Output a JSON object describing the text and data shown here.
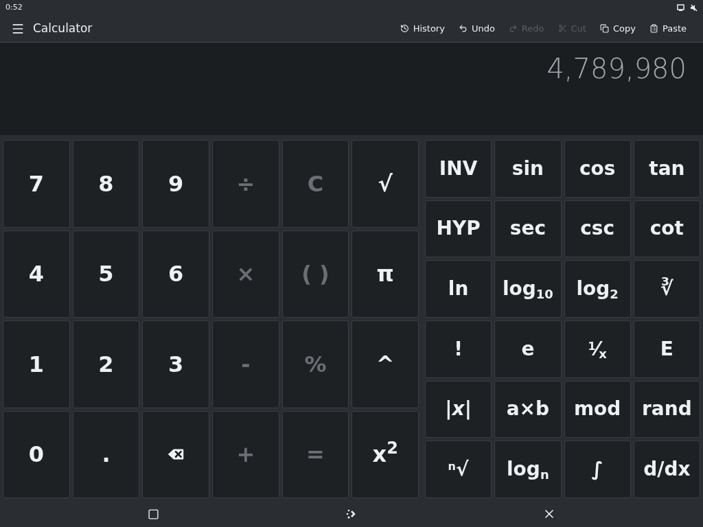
{
  "status_bar": {
    "time": "0:52"
  },
  "header": {
    "title": "Calculator",
    "actions": [
      {
        "label": "History",
        "kind": "clock",
        "disabled": false
      },
      {
        "label": "Undo",
        "kind": "undo",
        "disabled": false
      },
      {
        "label": "Redo",
        "kind": "redo",
        "disabled": true
      },
      {
        "label": "Cut",
        "kind": "cut",
        "disabled": true
      },
      {
        "label": "Copy",
        "kind": "copy",
        "disabled": false
      },
      {
        "label": "Paste",
        "kind": "paste",
        "disabled": false
      }
    ]
  },
  "display": {
    "result": "4,789,980"
  },
  "basic_keys": [
    {
      "kind": "text",
      "label": "7",
      "disabled": false
    },
    {
      "kind": "text",
      "label": "8",
      "disabled": false
    },
    {
      "kind": "text",
      "label": "9",
      "disabled": false
    },
    {
      "kind": "text",
      "label": "÷",
      "disabled": true
    },
    {
      "kind": "text",
      "label": "C",
      "disabled": true
    },
    {
      "kind": "text",
      "label": "√",
      "disabled": false
    },
    {
      "kind": "text",
      "label": "4",
      "disabled": false
    },
    {
      "kind": "text",
      "label": "5",
      "disabled": false
    },
    {
      "kind": "text",
      "label": "6",
      "disabled": false
    },
    {
      "kind": "text",
      "label": "×",
      "disabled": true
    },
    {
      "kind": "text",
      "label": "( )",
      "disabled": true
    },
    {
      "kind": "text",
      "label": "π",
      "disabled": false
    },
    {
      "kind": "text",
      "label": "1",
      "disabled": false
    },
    {
      "kind": "text",
      "label": "2",
      "disabled": false
    },
    {
      "kind": "text",
      "label": "3",
      "disabled": false
    },
    {
      "kind": "text",
      "label": "-",
      "disabled": true
    },
    {
      "kind": "text",
      "label": "%",
      "disabled": true
    },
    {
      "kind": "text",
      "label": "^",
      "disabled": false
    },
    {
      "kind": "text",
      "label": "0",
      "disabled": false
    },
    {
      "kind": "text",
      "label": ".",
      "disabled": false
    },
    {
      "kind": "backspace",
      "disabled": false
    },
    {
      "kind": "text",
      "label": "+",
      "disabled": true
    },
    {
      "kind": "text",
      "label": "=",
      "disabled": true
    },
    {
      "kind": "text",
      "label": "x$^{2}$",
      "disabled": false
    }
  ],
  "scientific_keys": [
    {
      "label": "INV"
    },
    {
      "label": "sin"
    },
    {
      "label": "cos"
    },
    {
      "label": "tan"
    },
    {
      "label": "HYP"
    },
    {
      "label": "sec"
    },
    {
      "label": "csc"
    },
    {
      "label": "cot"
    },
    {
      "label": "ln"
    },
    {
      "label": "log$_{10}$"
    },
    {
      "label": "log$_{2}$"
    },
    {
      "label": "∛"
    },
    {
      "label": "!"
    },
    {
      "label": "e"
    },
    {
      "label": "$^{1}$⁄$_{x}$"
    },
    {
      "label": "E"
    },
    {
      "label": "|*x*|"
    },
    {
      "label": "a×b"
    },
    {
      "label": "mod"
    },
    {
      "label": "rand"
    },
    {
      "label": "$^{n}$√"
    },
    {
      "label": "log$_{n}$"
    },
    {
      "label": "∫"
    },
    {
      "label": "d/dx"
    }
  ]
}
